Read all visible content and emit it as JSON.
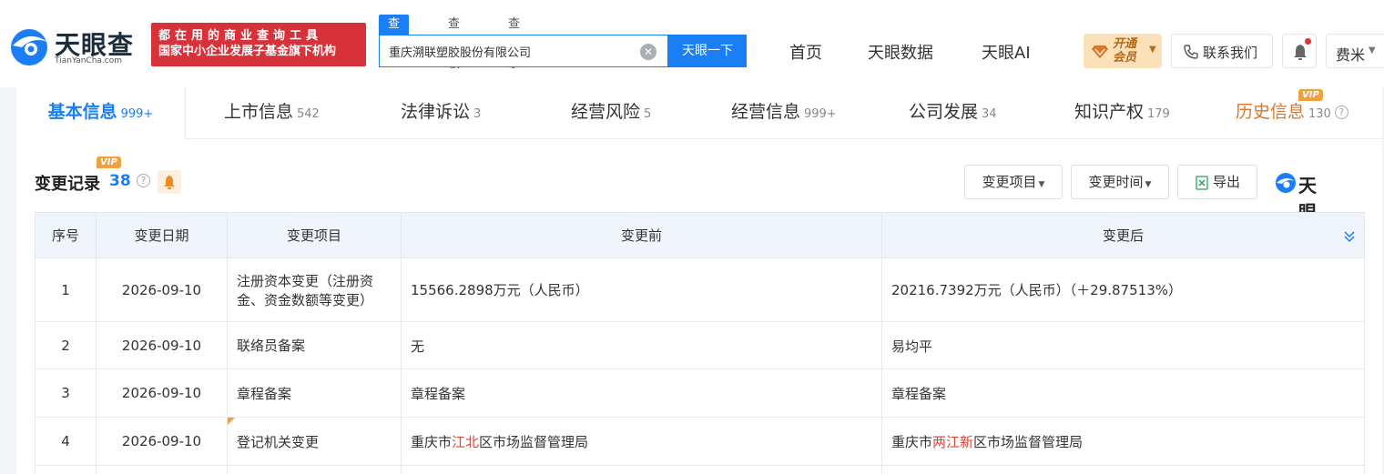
{
  "header": {
    "logo_text": "天眼查",
    "logo_sub": "TianYanCha.com",
    "slogan_line1": "都在用的商业查询工具",
    "slogan_line2": "国家中小企业发展子基金旗下机构",
    "search_tabs": [
      "查公司",
      "查老板",
      "查关系"
    ],
    "search_value": "重庆溯联塑胶股份有限公司",
    "search_button": "天眼一下",
    "nav": [
      "首页",
      "天眼数据",
      "天眼AI"
    ],
    "vip_open_line1": "开通",
    "vip_open_line2": "会员",
    "contact": "联系我们",
    "user": "费米"
  },
  "tabs": [
    {
      "label": "基本信息",
      "count": "999+"
    },
    {
      "label": "上市信息",
      "count": "542"
    },
    {
      "label": "法律诉讼",
      "count": "3"
    },
    {
      "label": "经营风险",
      "count": "5"
    },
    {
      "label": "经营信息",
      "count": "999+"
    },
    {
      "label": "公司发展",
      "count": "34"
    },
    {
      "label": "知识产权",
      "count": "179"
    },
    {
      "label": "历史信息",
      "count": "130"
    }
  ],
  "vip_tag": "VIP",
  "section": {
    "title": "变更记录",
    "count": "38",
    "filter_item": "变更项目",
    "filter_time": "变更时间",
    "export": "导出",
    "watermark": "天眼查"
  },
  "table": {
    "headers": [
      "序号",
      "变更日期",
      "变更项目",
      "变更前",
      "变更后"
    ],
    "rows": [
      {
        "no": "1",
        "date": "2026-09-10",
        "item": "注册资本变更（注册资金、资金数额等变更）",
        "before": "15566.2898万元（人民币）",
        "after": "20216.7392万元（人民币）（＋29.87513%）"
      },
      {
        "no": "2",
        "date": "2026-09-10",
        "item": "联络员备案",
        "before": "无",
        "after": "易均平"
      },
      {
        "no": "3",
        "date": "2026-09-10",
        "item": "章程备案",
        "before": "章程备案",
        "after": "章程备案"
      },
      {
        "no": "4",
        "date": "2026-09-10",
        "item": "登记机关变更",
        "before_parts": [
          "重庆市",
          "江北",
          "区市场监督管理局"
        ],
        "after_parts": [
          "重庆市",
          "两江新",
          "区市场监督管理局"
        ]
      }
    ]
  },
  "colors": {
    "accent": "#1a7ef4",
    "highlight": "#d8453a",
    "slogan_bg": "#d7313a",
    "vip": "#f0a13f"
  }
}
